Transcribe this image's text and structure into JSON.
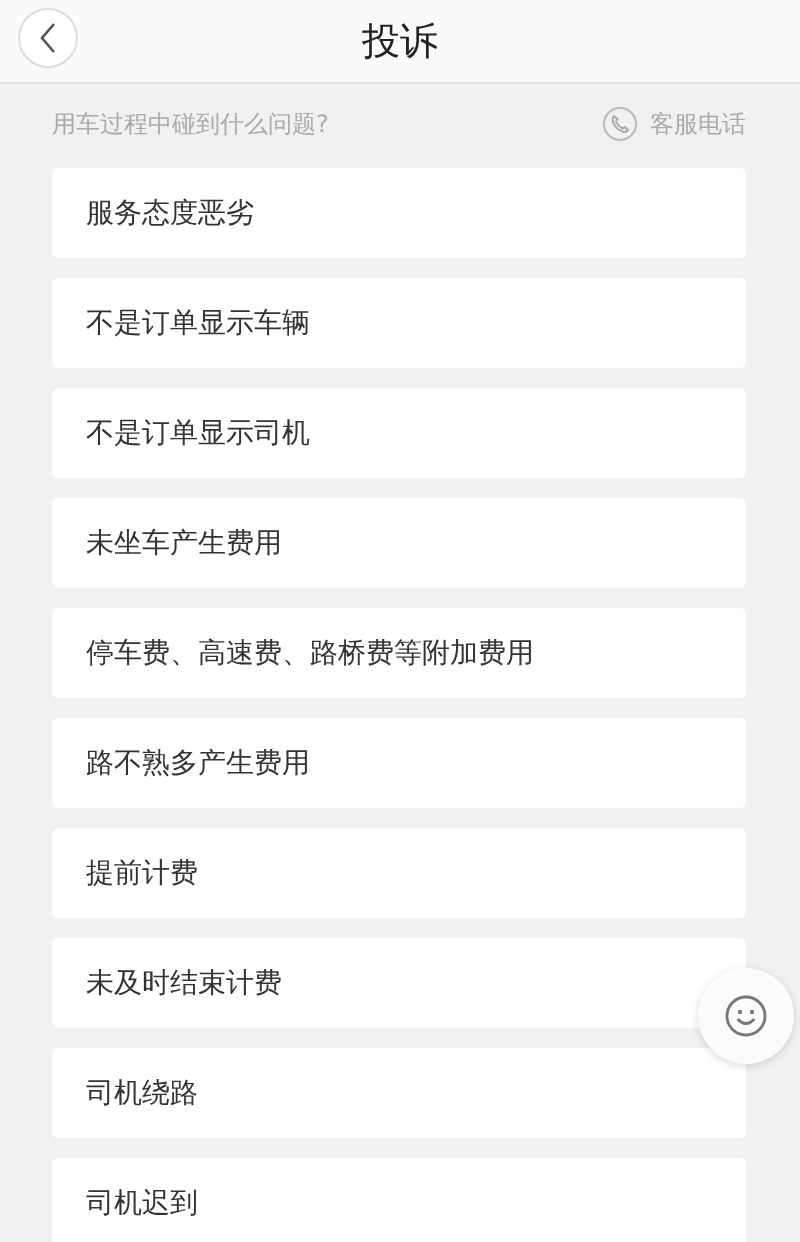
{
  "header": {
    "title": "投诉"
  },
  "prompt": {
    "question": "用车过程中碰到什么问题?",
    "service_link": "客服电话"
  },
  "reasons": [
    {
      "label": "服务态度恶劣"
    },
    {
      "label": "不是订单显示车辆"
    },
    {
      "label": "不是订单显示司机"
    },
    {
      "label": "未坐车产生费用"
    },
    {
      "label": "停车费、高速费、路桥费等附加费用"
    },
    {
      "label": "路不熟多产生费用"
    },
    {
      "label": "提前计费"
    },
    {
      "label": "未及时结束计费"
    },
    {
      "label": "司机绕路"
    },
    {
      "label": "司机迟到"
    }
  ]
}
